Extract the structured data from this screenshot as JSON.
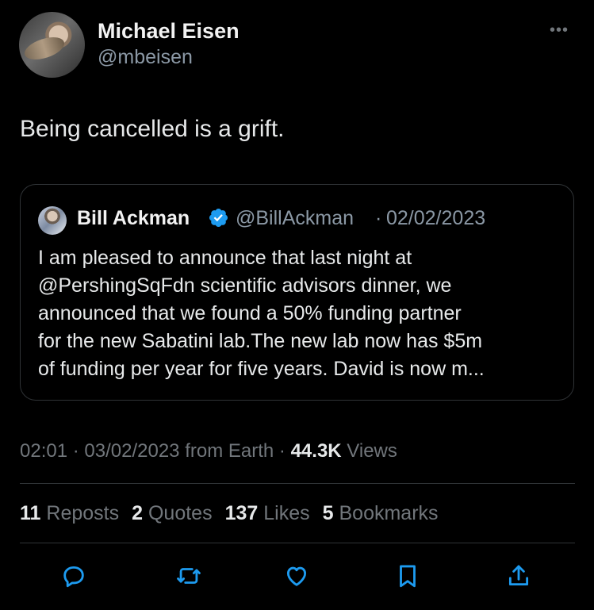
{
  "post": {
    "author_name": "Michael Eisen",
    "author_handle": "@mbeisen",
    "more_icon": "more-icon",
    "text": "Being cancelled is a grift."
  },
  "quoted": {
    "author_name": "Bill Ackman",
    "author_handle": "@BillAckman",
    "separator": "·",
    "date": "02/02/2023",
    "verified_color": "#1d9bf0",
    "lines": [
      "I am pleased to announce that last night at",
      "@PershingSqFdn scientific advisors dinner, we",
      "announced that we found a 50% funding partner",
      "for the new Sabatini lab.The new lab now has $5m",
      "of funding per year for five years. David is now m..."
    ]
  },
  "meta": {
    "time": "02:01",
    "sep1": "·",
    "date": "03/02/2023",
    "source": "from Earth",
    "sep2": "·",
    "views_count": "44.3K",
    "views_label": "Views"
  },
  "stats": {
    "reposts_count": "11",
    "reposts_label": "Reposts",
    "quotes_count": "2",
    "quotes_label": "Quotes",
    "likes_count": "137",
    "likes_label": "Likes",
    "bookmarks_count": "5",
    "bookmarks_label": "Bookmarks"
  },
  "actions": [
    {
      "icon": "reply-icon"
    },
    {
      "icon": "repost-icon"
    },
    {
      "icon": "like-icon"
    },
    {
      "icon": "bookmark-icon"
    },
    {
      "icon": "share-icon"
    }
  ],
  "colors": {
    "background": "#000000",
    "text_primary": "#e7e9ea",
    "text_secondary": "#71767b",
    "border": "#2f3336"
  }
}
